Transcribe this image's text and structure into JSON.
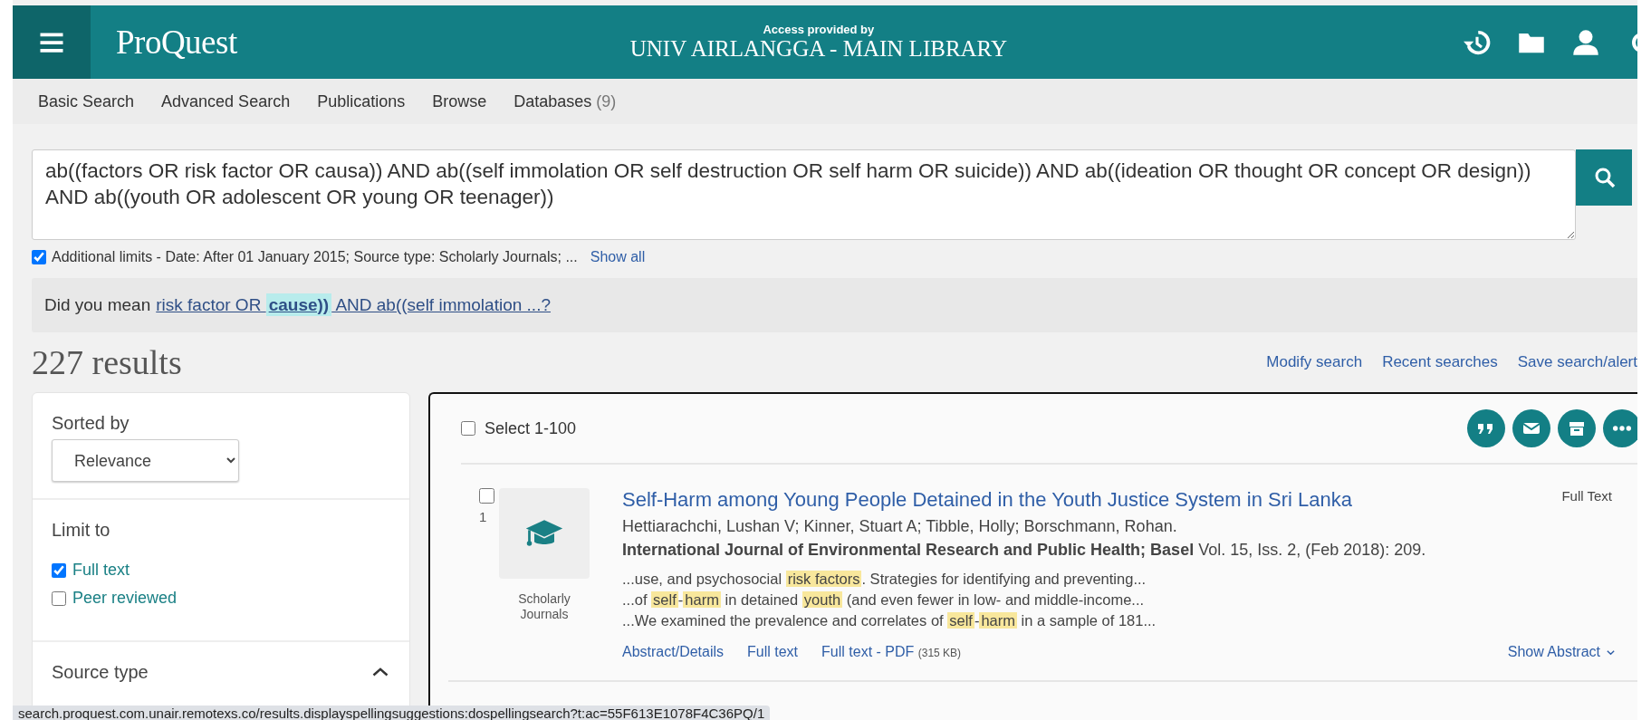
{
  "header": {
    "logo": "ProQuest",
    "access_label": "Access provided by",
    "institution": "UNIV AIRLANGGA - MAIN LIBRARY"
  },
  "nav": [
    {
      "label": "Basic Search"
    },
    {
      "label": "Advanced Search"
    },
    {
      "label": "Publications"
    },
    {
      "label": "Browse"
    },
    {
      "label": "Databases",
      "count": "(9)"
    }
  ],
  "search": {
    "value": "ab((factors OR risk factor OR causa)) AND ab((self immolation OR self destruction OR self harm OR suicide)) AND ab((ideation OR thought OR concept OR design)) AND ab((youth OR adolescent OR young OR teenager))",
    "limits_checked": true,
    "limits": "Additional limits - Date: After 01 January 2015; Source type: Scholarly Journals; ...",
    "show_all": "Show all"
  },
  "suggestion": {
    "prefix": "Did you mean",
    "parts": [
      {
        "text": "risk factor OR ",
        "highlight": false
      },
      {
        "text": "cause))",
        "highlight": true
      },
      {
        "text": " AND ab((self immolation ...?",
        "highlight": false
      }
    ]
  },
  "results_count": "227 results",
  "actions": [
    "Modify search",
    "Recent searches",
    "Save search/alert"
  ],
  "sidebar": {
    "sort_label": "Sorted by",
    "sort_value": "Relevance",
    "limit_label": "Limit to",
    "limits": [
      {
        "label": "Full text",
        "checked": true
      },
      {
        "label": "Peer reviewed",
        "checked": false
      }
    ],
    "section": {
      "label": "Source type",
      "expanded": true
    }
  },
  "results": {
    "select_label": "Select 1-100",
    "select_checked": false,
    "items": [
      {
        "number": "1",
        "checked": false,
        "type_label": "Scholarly Journals",
        "title": "Self-Harm among Young People Detained in the Youth Justice System in Sri Lanka",
        "authors": "Hettiarachchi, Lushan V; Kinner, Stuart A; Tibble, Holly; Borschmann, Rohan.",
        "source": "**International Journal of Environmental Research and Public Health; Basel** Vol. 15, Iss. 2,  (Feb 2018): 209.",
        "badge": "Full Text",
        "snippets": [
          [
            {
              "text": "...use, and psychosocial ",
              "highlight": false
            },
            {
              "text": "risk factors",
              "highlight": true
            },
            {
              "text": ". Strategies for identifying and preventing...",
              "highlight": false
            }
          ],
          [
            {
              "text": "...of ",
              "highlight": false
            },
            {
              "text": "self",
              "highlight": true
            },
            {
              "text": "-",
              "highlight": false
            },
            {
              "text": "harm",
              "highlight": true
            },
            {
              "text": " in detained ",
              "highlight": false
            },
            {
              "text": "youth",
              "highlight": true
            },
            {
              "text": " (and even fewer in low- and middle-income...",
              "highlight": false
            }
          ],
          [
            {
              "text": "...We examined the prevalence and correlates of ",
              "highlight": false
            },
            {
              "text": "self",
              "highlight": true
            },
            {
              "text": "-",
              "highlight": false
            },
            {
              "text": "harm",
              "highlight": true
            },
            {
              "text": " in a sample of 181...",
              "highlight": false
            }
          ]
        ],
        "links": [
          "Abstract/Details",
          "Full text"
        ],
        "pdf": {
          "label": "Full text - PDF",
          "size": "(315 KB)"
        },
        "show_abstract": "Show Abstract"
      }
    ]
  },
  "status_url": "search.proquest.com.unair.remotexs.co/results.displayspellingsuggestions:dospellingsearch?t:ac=55F613E1078F4C36PQ/1"
}
